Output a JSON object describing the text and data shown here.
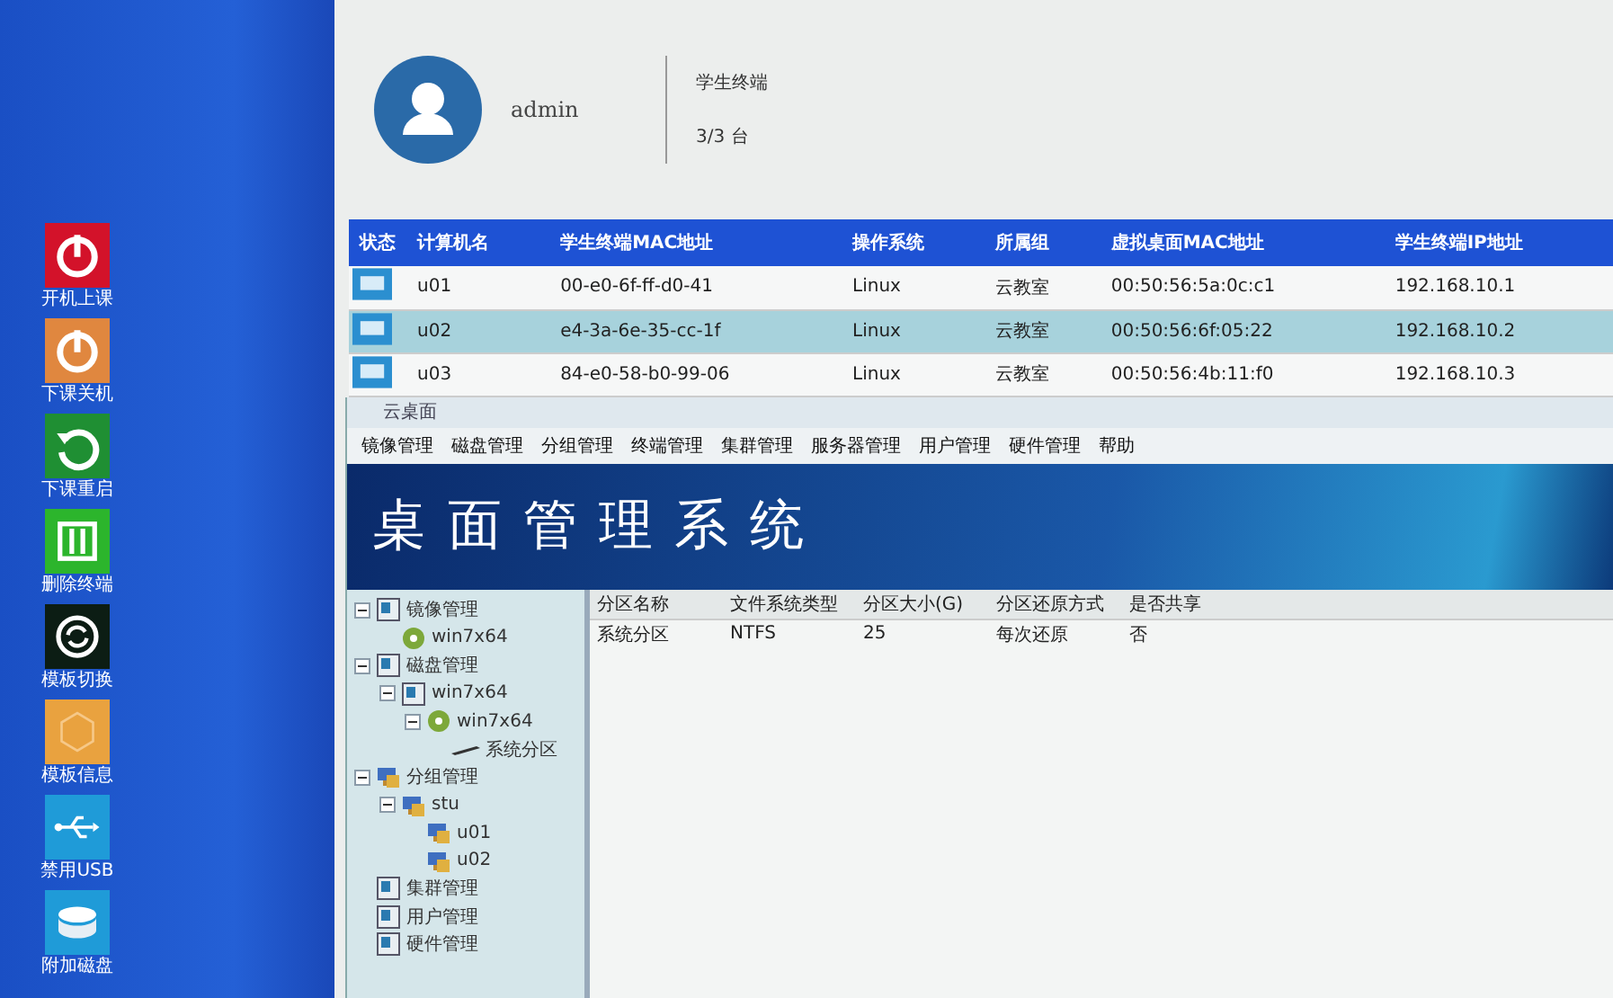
{
  "sidebar": {
    "tiles": [
      {
        "label": "开机上课",
        "kind": "power",
        "color": "#d3122a"
      },
      {
        "label": "下课关机",
        "kind": "power",
        "color": "#e0873f"
      },
      {
        "label": "下课重启",
        "kind": "restart",
        "color": "#1f8f33"
      },
      {
        "label": "删除终端",
        "kind": "delete",
        "color": "#2cb52c"
      },
      {
        "label": "模板切换",
        "kind": "switch",
        "color": "#0c1d14"
      },
      {
        "label": "模板信息",
        "kind": "info",
        "color": "#e9a23f"
      },
      {
        "label": "禁用USB",
        "kind": "usb",
        "color": "#1f9bd8"
      },
      {
        "label": "附加磁盘",
        "kind": "disk",
        "color": "#1f9bd8"
      }
    ]
  },
  "user": {
    "name": "admin",
    "panel_title": "学生终端",
    "count": "3/3 台"
  },
  "table": {
    "columns": [
      "状态",
      "计算机名",
      "学生终端MAC地址",
      "操作系统",
      "所属组",
      "虚拟桌面MAC地址",
      "学生终端IP地址"
    ],
    "rows": [
      {
        "name": "u01",
        "mac": "00-e0-6f-ff-d0-41",
        "os": "Linux",
        "group": "云教室",
        "vmac": "00:50:56:5a:0c:c1",
        "ip": "192.168.10.1",
        "selected": false
      },
      {
        "name": "u02",
        "mac": "e4-3a-6e-35-cc-1f",
        "os": "Linux",
        "group": "云教室",
        "vmac": "00:50:56:6f:05:22",
        "ip": "192.168.10.2",
        "selected": true
      },
      {
        "name": "u03",
        "mac": "84-e0-58-b0-99-06",
        "os": "Linux",
        "group": "云教室",
        "vmac": "00:50:56:4b:11:f0",
        "ip": "192.168.10.3",
        "selected": false
      }
    ]
  },
  "window": {
    "title": "云桌面",
    "menu": [
      "镜像管理",
      "磁盘管理",
      "分组管理",
      "终端管理",
      "集群管理",
      "服务器管理",
      "用户管理",
      "硬件管理",
      "帮助"
    ],
    "banner": "桌面管理系统",
    "tree": [
      {
        "label": "镜像管理",
        "kind": "image",
        "expanded": true,
        "children": [
          {
            "label": "win7x64",
            "kind": "os"
          }
        ]
      },
      {
        "label": "磁盘管理",
        "kind": "disk",
        "expanded": true,
        "children": [
          {
            "label": "win7x64",
            "kind": "desktop",
            "expanded": true,
            "children": [
              {
                "label": "win7x64",
                "kind": "os",
                "expanded": true,
                "children": [
                  {
                    "label": "系统分区",
                    "kind": "partition"
                  }
                ]
              }
            ]
          }
        ]
      },
      {
        "label": "分组管理",
        "kind": "group",
        "expanded": true,
        "children": [
          {
            "label": "stu",
            "kind": "group",
            "expanded": true,
            "children": [
              {
                "label": "u01",
                "kind": "computer"
              },
              {
                "label": "u02",
                "kind": "computer"
              }
            ]
          }
        ]
      },
      {
        "label": "集群管理",
        "kind": "panel"
      },
      {
        "label": "用户管理",
        "kind": "panel"
      },
      {
        "label": "硬件管理",
        "kind": "panel"
      }
    ],
    "partitions": {
      "columns": [
        "分区名称",
        "文件系统类型",
        "分区大小(G)",
        "分区还原方式",
        "是否共享"
      ],
      "rows": [
        [
          "系统分区",
          "NTFS",
          "25",
          "每次还原",
          "否"
        ]
      ]
    }
  }
}
